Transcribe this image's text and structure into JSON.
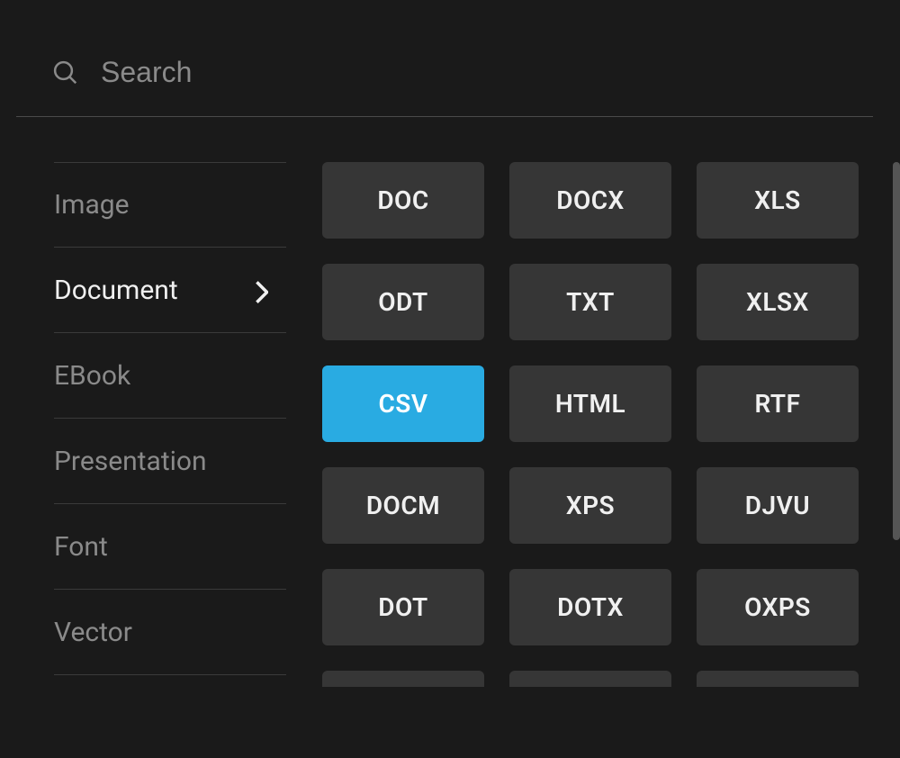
{
  "search": {
    "placeholder": "Search",
    "value": ""
  },
  "colors": {
    "accent": "#29abe2",
    "tile_bg": "#363636",
    "text_muted": "#8a8a8a",
    "text": "#f0f0f0"
  },
  "sidebar": {
    "items": [
      {
        "label": "Image",
        "active": false
      },
      {
        "label": "Document",
        "active": true
      },
      {
        "label": "EBook",
        "active": false
      },
      {
        "label": "Presentation",
        "active": false
      },
      {
        "label": "Font",
        "active": false
      },
      {
        "label": "Vector",
        "active": false
      }
    ]
  },
  "formats": {
    "highlighted": "CSV",
    "items": [
      "DOC",
      "DOCX",
      "XLS",
      "ODT",
      "TXT",
      "XLSX",
      "CSV",
      "HTML",
      "RTF",
      "DOCM",
      "XPS",
      "DJVU",
      "DOT",
      "DOTX",
      "OXPS"
    ]
  }
}
